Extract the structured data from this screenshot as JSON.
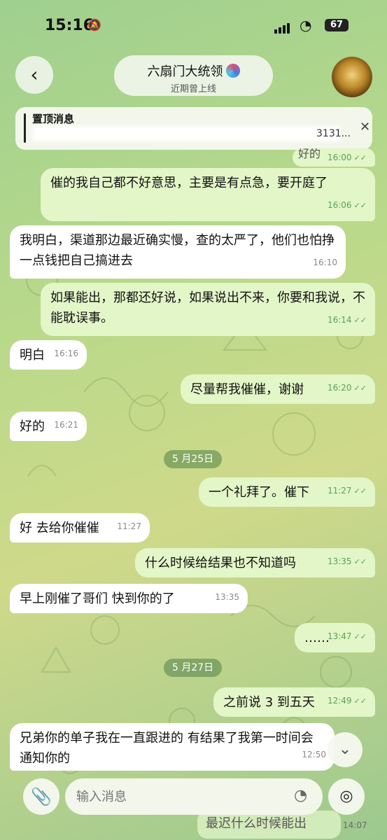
{
  "status_bar": {
    "time": "15:16",
    "battery": "67"
  },
  "header": {
    "title": "六扇门大统领",
    "subtitle": "近期曾上线"
  },
  "pinned": {
    "label": "置顶消息",
    "text": "3131..."
  },
  "messages": [
    {
      "text": "好的",
      "time": "16:00",
      "dir": "out"
    },
    {
      "text": "催的我自己都不好意思，主要是有点急，要开庭了",
      "time": "16:06",
      "dir": "out"
    },
    {
      "text": "我明白，渠道那边最近确实慢，查的太严了，他们也怕挣一点钱把自己搞进去",
      "time": "16:10",
      "dir": "in"
    },
    {
      "text": "如果能出，那都还好说，如果说出不来，你要和我说，不能耽误事。",
      "time": "16:14",
      "dir": "out"
    },
    {
      "text": "明白",
      "time": "16:16",
      "dir": "in"
    },
    {
      "text": "尽量帮我催催，谢谢",
      "time": "16:20",
      "dir": "out"
    },
    {
      "text": "好的",
      "time": "16:21",
      "dir": "in"
    },
    {
      "text": "一个礼拜了。催下",
      "time": "11:27",
      "dir": "out"
    },
    {
      "text": "好 去给你催催",
      "time": "11:27",
      "dir": "in"
    },
    {
      "text": "什么时候给结果也不知道吗",
      "time": "13:35",
      "dir": "out"
    },
    {
      "text": "早上刚催了哥们  快到你的了",
      "time": "13:35",
      "dir": "in"
    },
    {
      "text": "……",
      "time": "13:47",
      "dir": "out"
    },
    {
      "text": "之前说 3 到五天",
      "time": "12:49",
      "dir": "out"
    },
    {
      "text": "兄弟你的单子我在一直跟进的 有结果了我第一时间会通知你的",
      "time": "12:50",
      "dir": "in"
    },
    {
      "text": "最迟什么时候能出",
      "time": "14:07",
      "dir": "out"
    }
  ],
  "dates": [
    "5 月25日",
    "5 月27日"
  ],
  "input": {
    "placeholder": "输入消息"
  },
  "colors": {
    "incoming_bubble": "#ffffff",
    "outgoing_bubble": "#e3f6c8",
    "timestamp_green": "#58a356"
  }
}
